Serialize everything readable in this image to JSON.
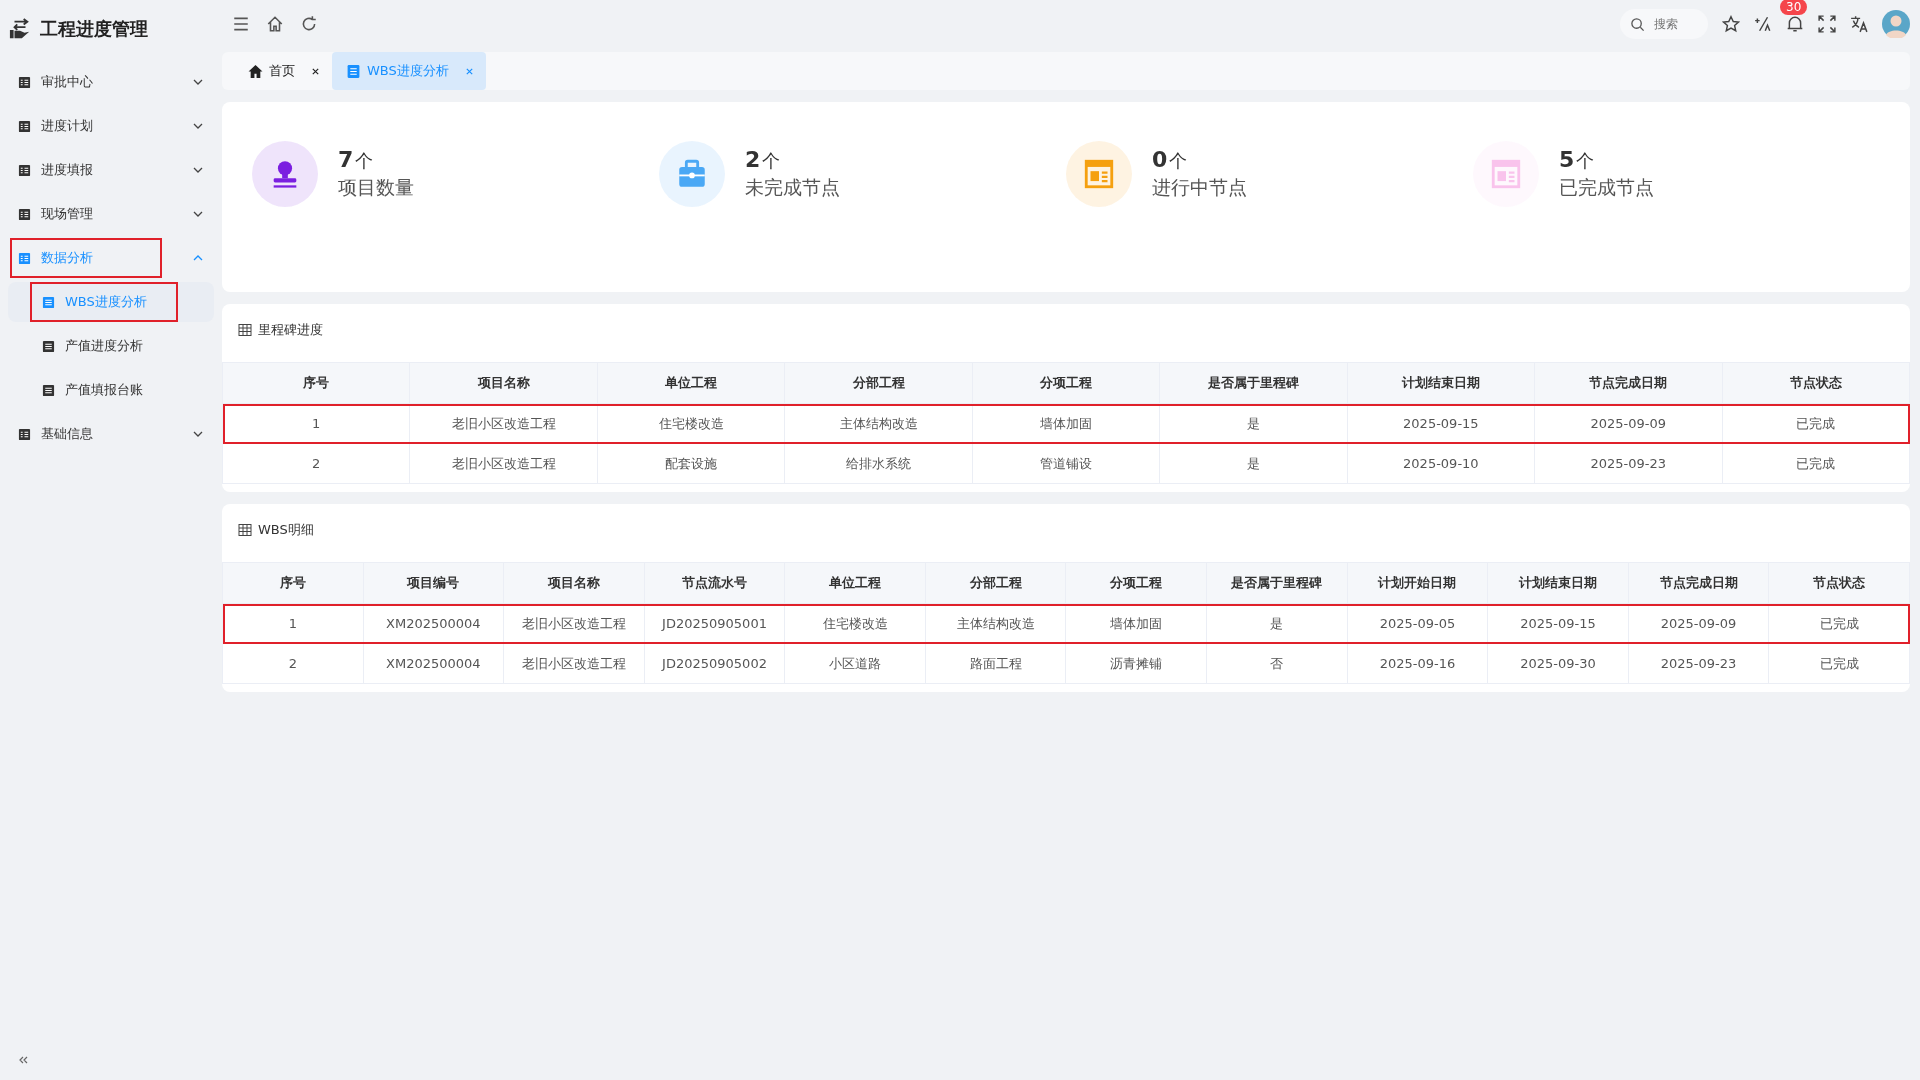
{
  "app": {
    "title": "工程进度管理"
  },
  "sidebar": {
    "items": [
      {
        "label": "审批中心",
        "expanded": false,
        "selected": false,
        "highlighted": false
      },
      {
        "label": "进度计划",
        "expanded": false,
        "selected": false,
        "highlighted": false
      },
      {
        "label": "进度填报",
        "expanded": false,
        "selected": false,
        "highlighted": false
      },
      {
        "label": "现场管理",
        "expanded": false,
        "selected": false,
        "highlighted": false
      },
      {
        "label": "数据分析",
        "expanded": true,
        "selected": true,
        "highlighted": true,
        "children": [
          {
            "label": "WBS进度分析",
            "selected": true,
            "highlighted": true
          },
          {
            "label": "产值进度分析",
            "selected": false,
            "highlighted": false
          },
          {
            "label": "产值填报台账",
            "selected": false,
            "highlighted": false
          }
        ]
      },
      {
        "label": "基础信息",
        "expanded": false,
        "selected": false,
        "highlighted": false
      }
    ]
  },
  "header": {
    "search": {
      "placeholder": "搜索"
    },
    "notifications": "30"
  },
  "tabs": [
    {
      "label": "首页",
      "selected": false,
      "kind": "home"
    },
    {
      "label": "WBS进度分析",
      "selected": true,
      "kind": "page"
    }
  ],
  "stats": [
    {
      "value": "7",
      "unit": "个",
      "label": "项目数量",
      "color": "#7b1fe0",
      "kind": "stamp"
    },
    {
      "value": "2",
      "unit": "个",
      "label": "未完成节点",
      "color": "#4aa8f5",
      "kind": "toolbox"
    },
    {
      "value": "0",
      "unit": "个",
      "label": "进行中节点",
      "color": "#f5a00f",
      "kind": "window"
    },
    {
      "value": "5",
      "unit": "个",
      "label": "已完成节点",
      "color": "#f9c3ec",
      "kind": "window"
    }
  ],
  "milestone_table": {
    "title": "里程碑进度",
    "columns": [
      "序号",
      "项目名称",
      "单位工程",
      "分部工程",
      "分项工程",
      "是否属于里程碑",
      "计划结束日期",
      "节点完成日期",
      "节点状态"
    ],
    "rows": [
      {
        "cells": [
          "1",
          "老旧小区改造工程",
          "住宅楼改造",
          "主体结构改造",
          "墙体加固",
          "是",
          "2025-09-15",
          "2025-09-09",
          "已完成"
        ],
        "highlighted": true
      },
      {
        "cells": [
          "2",
          "老旧小区改造工程",
          "配套设施",
          "给排水系统",
          "管道铺设",
          "是",
          "2025-09-10",
          "2025-09-23",
          "已完成"
        ],
        "highlighted": false
      }
    ]
  },
  "wbs_table": {
    "title": "WBS明细",
    "columns": [
      "序号",
      "项目编号",
      "项目名称",
      "节点流水号",
      "单位工程",
      "分部工程",
      "分项工程",
      "是否属于里程碑",
      "计划开始日期",
      "计划结束日期",
      "节点完成日期",
      "节点状态"
    ],
    "rows": [
      {
        "cells": [
          "1",
          "XM202500004",
          "老旧小区改造工程",
          "JD20250905001",
          "住宅楼改造",
          "主体结构改造",
          "墙体加固",
          "是",
          "2025-09-05",
          "2025-09-15",
          "2025-09-09",
          "已完成"
        ],
        "highlighted": true
      },
      {
        "cells": [
          "2",
          "XM202500004",
          "老旧小区改造工程",
          "JD20250905002",
          "小区道路",
          "路面工程",
          "沥青摊铺",
          "否",
          "2025-09-16",
          "2025-09-30",
          "2025-09-23",
          "已完成"
        ],
        "highlighted": false
      }
    ]
  }
}
